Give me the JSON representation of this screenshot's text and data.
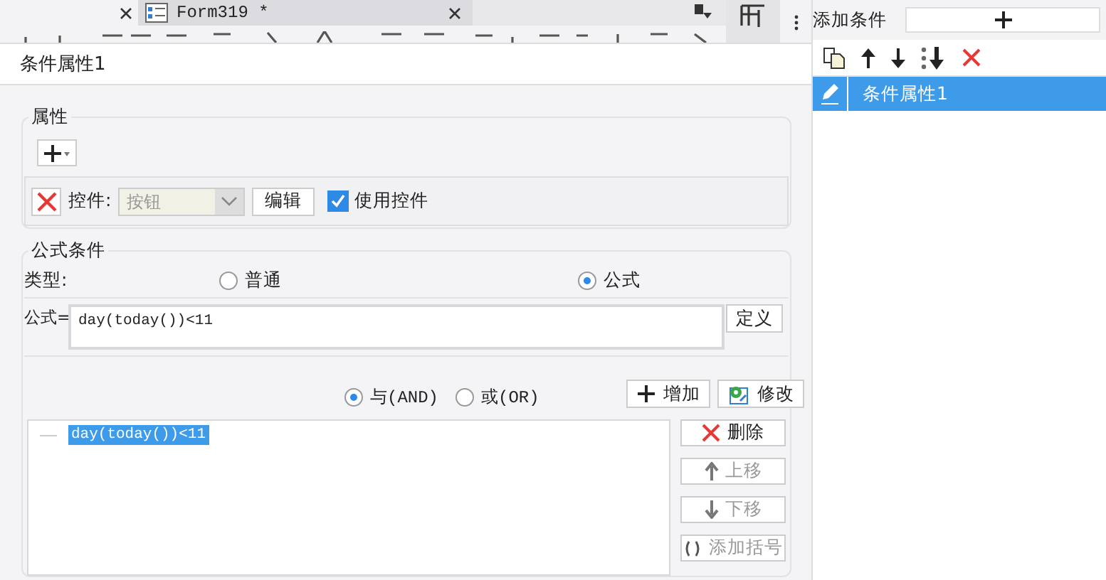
{
  "app_tabs": [
    {
      "label": "Form319 *"
    }
  ],
  "dialog": {
    "title": "条件属性1",
    "property_group": {
      "title": "属性",
      "control_row": {
        "label": "控件:",
        "value": "按钮",
        "combo_disabled": true,
        "edit_button": "编辑",
        "use_control": {
          "label": "使用控件",
          "checked": true
        }
      }
    },
    "formula_group": {
      "title": "公式条件",
      "type_label": "类型:",
      "type_options": [
        {
          "label": "普通",
          "selected": false
        },
        {
          "label": "公式",
          "selected": true
        }
      ],
      "formula_label": "公式=",
      "formula_value": "day(today())<11",
      "define_button": "定义",
      "logic_options": [
        {
          "label": "与(AND)",
          "selected": true
        },
        {
          "label": "或(OR)",
          "selected": false
        }
      ],
      "add_button": "增加",
      "modify_button": "修改",
      "conditions": [
        {
          "text": "day(today())<11",
          "selected": true
        }
      ],
      "side_buttons": [
        {
          "kind": "delete",
          "label": "删除",
          "disabled": false
        },
        {
          "kind": "up",
          "label": "上移",
          "disabled": true
        },
        {
          "kind": "down",
          "label": "下移",
          "disabled": true
        },
        {
          "kind": "bracket",
          "label": "添加括号",
          "disabled": true
        }
      ]
    }
  },
  "condition_panel": {
    "title": "添加条件",
    "items": [
      {
        "label": "条件属性1",
        "selected": true
      }
    ]
  }
}
